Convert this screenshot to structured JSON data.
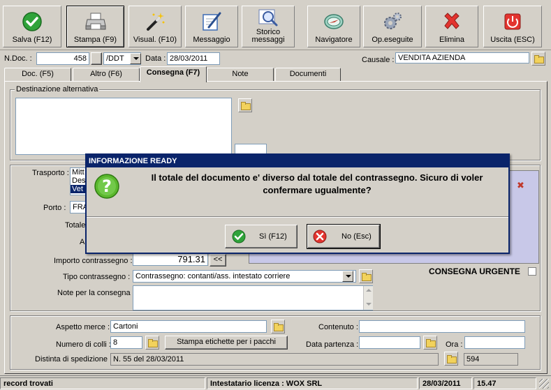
{
  "toolbar": {
    "save": "Salva (F12)",
    "print": "Stampa (F9)",
    "view": "Visual. (F10)",
    "message": "Messaggio",
    "history": "Storico messaggi",
    "navigator": "Navigatore",
    "ops": "Op.eseguite",
    "delete": "Elimina",
    "exit": "Uscita (ESC)"
  },
  "header": {
    "ndoc_label": "N.Doc. :",
    "ndoc_value": "458",
    "series_value": "/DDT",
    "date_label": "Data :",
    "date_value": "28/03/2011",
    "causale_label": "Causale :",
    "causale_value": "VENDITA AZIENDA"
  },
  "tabs": [
    "Doc. (F5)",
    "Altro (F6)",
    "Consegna (F7)",
    "Note",
    "Documenti"
  ],
  "consegna": {
    "dest_alt_title": "Destinazione alternativa",
    "trasporto_label": "Trasporto :",
    "trasporto_opts": [
      "Mitt",
      "Des",
      "Vet"
    ],
    "porto_label": "Porto :",
    "porto_value": "FRA",
    "totale_label": "Totale",
    "a_label": "A",
    "importo_label": "Importo contrassegno :",
    "importo_value": "791.31",
    "back_label": "<<",
    "tipo_label": "Tipo contrassegno :",
    "tipo_value": "Contrassegno: contanti/ass. intestato corriere",
    "note_label": "Note per la consegna",
    "urgente_label": "CONSEGNA URGENTE"
  },
  "merce": {
    "aspetto_label": "Aspetto merce :",
    "aspetto_value": "Cartoni",
    "contenuto_label": "Contenuto :",
    "colli_label": "Numero di colli :",
    "colli_value": "8",
    "stampa_label": "Stampa etichette per i pacchi",
    "partenza_label": "Data partenza :",
    "ora_label": "Ora :",
    "distinta_label": "Distinta di spedizione :",
    "distinta_value": "N. 55 del 28/03/2011",
    "distinta_num": "594"
  },
  "dialog": {
    "title": "INFORMAZIONE READY",
    "message": "Il totale del documento e' diverso dal totale del contrassegno. Sicuro di voler confermare ugualmente?",
    "yes": "Sì (F12)",
    "no": "No (Esc)"
  },
  "status": {
    "records": "record trovati",
    "license": "Intestatario licenza : WOX SRL",
    "date": "28/03/2011",
    "time": "15.47"
  },
  "colors": {
    "titlebar": "#0a246a",
    "face": "#d4d0c8",
    "selection": "#0a246a"
  }
}
